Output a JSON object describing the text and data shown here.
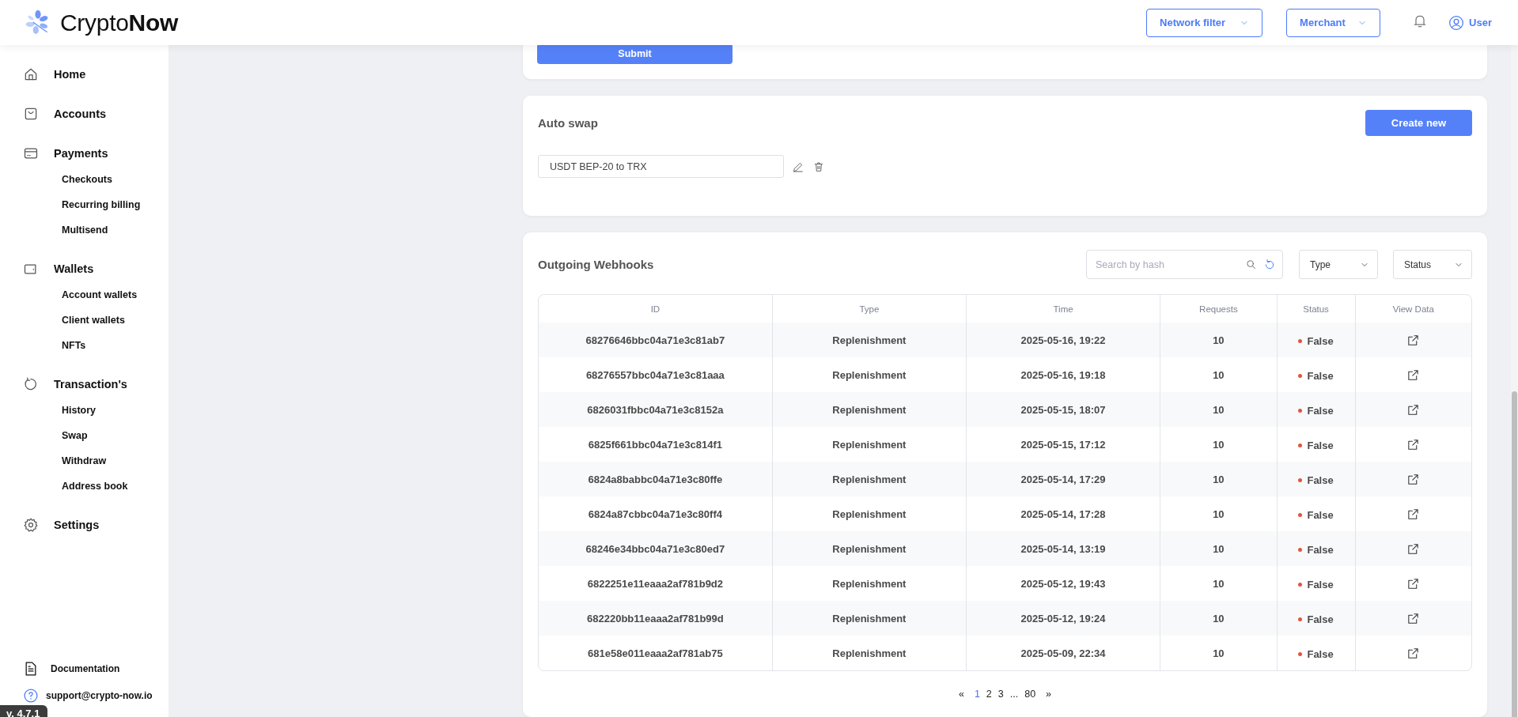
{
  "header": {
    "logo": "Crypto**Now**",
    "network_filter": "Network filter",
    "merchant": "Merchant",
    "user": "User"
  },
  "sidebar": {
    "items": [
      {
        "label": "Home"
      },
      {
        "label": "Accounts"
      },
      {
        "label": "Payments",
        "children": [
          {
            "label": "Checkouts"
          },
          {
            "label": "Recurring billing"
          },
          {
            "label": "Multisend"
          }
        ]
      },
      {
        "label": "Wallets",
        "children": [
          {
            "label": "Account wallets"
          },
          {
            "label": "Client wallets"
          },
          {
            "label": "NFTs"
          }
        ]
      },
      {
        "label": "Transaction's",
        "children": [
          {
            "label": "History"
          },
          {
            "label": "Swap"
          },
          {
            "label": "Withdraw"
          },
          {
            "label": "Address book"
          }
        ]
      },
      {
        "label": "Settings"
      }
    ],
    "footer": [
      {
        "label": "Documentation"
      },
      {
        "label": "support@crypto-now.io"
      }
    ],
    "version": "v. 4.7.1"
  },
  "top_form": {
    "submit": "Submit"
  },
  "auto_swap": {
    "title": "Auto swap",
    "create_button": "Create new",
    "rules": [
      {
        "value": "USDT BEP-20 to TRX"
      }
    ]
  },
  "webhooks": {
    "title": "Outgoing Webhooks",
    "search": {
      "placeholder": "Search by hash"
    },
    "filters": [
      "Type",
      "Status"
    ],
    "table": {
      "columns": [
        "ID",
        "Type",
        "Time",
        "Requests",
        "Status",
        "View Data"
      ],
      "rows": [
        {
          "id": "68276646bbc04a71e3c81ab7",
          "type": "Replenishment",
          "time": "2025-05-16, 19:22",
          "requests": "10",
          "status": "False"
        },
        {
          "id": "68276557bbc04a71e3c81aaa",
          "type": "Replenishment",
          "time": "2025-05-16, 19:18",
          "requests": "10",
          "status": "False"
        },
        {
          "id": "6826031fbbc04a71e3c8152a",
          "type": "Replenishment",
          "time": "2025-05-15, 18:07",
          "requests": "10",
          "status": "False"
        },
        {
          "id": "6825f661bbc04a71e3c814f1",
          "type": "Replenishment",
          "time": "2025-05-15, 17:12",
          "requests": "10",
          "status": "False"
        },
        {
          "id": "6824a8babbc04a71e3c80ffe",
          "type": "Replenishment",
          "time": "2025-05-14, 17:29",
          "requests": "10",
          "status": "False"
        },
        {
          "id": "6824a87cbbc04a71e3c80ff4",
          "type": "Replenishment",
          "time": "2025-05-14, 17:28",
          "requests": "10",
          "status": "False"
        },
        {
          "id": "68246e34bbc04a71e3c80ed7",
          "type": "Replenishment",
          "time": "2025-05-14, 13:19",
          "requests": "10",
          "status": "False"
        },
        {
          "id": "6822251e11eaaa2af781b9d2",
          "type": "Replenishment",
          "time": "2025-05-12, 19:43",
          "requests": "10",
          "status": "False"
        },
        {
          "id": "682220bb11eaaa2af781b99d",
          "type": "Replenishment",
          "time": "2025-05-12, 19:24",
          "requests": "10",
          "status": "False"
        },
        {
          "id": "681e58e011eaaa2af781ab75",
          "type": "Replenishment",
          "time": "2025-05-09, 22:34",
          "requests": "10",
          "status": "False"
        }
      ]
    },
    "pagination": {
      "prev": "«",
      "pages": [
        {
          "label": "1",
          "selected": true
        },
        {
          "label": "2",
          "selected": false
        },
        {
          "label": "3",
          "selected": false
        },
        {
          "label": "...",
          "selected": false
        },
        {
          "label": "80",
          "selected": false
        }
      ],
      "next": "»"
    }
  }
}
